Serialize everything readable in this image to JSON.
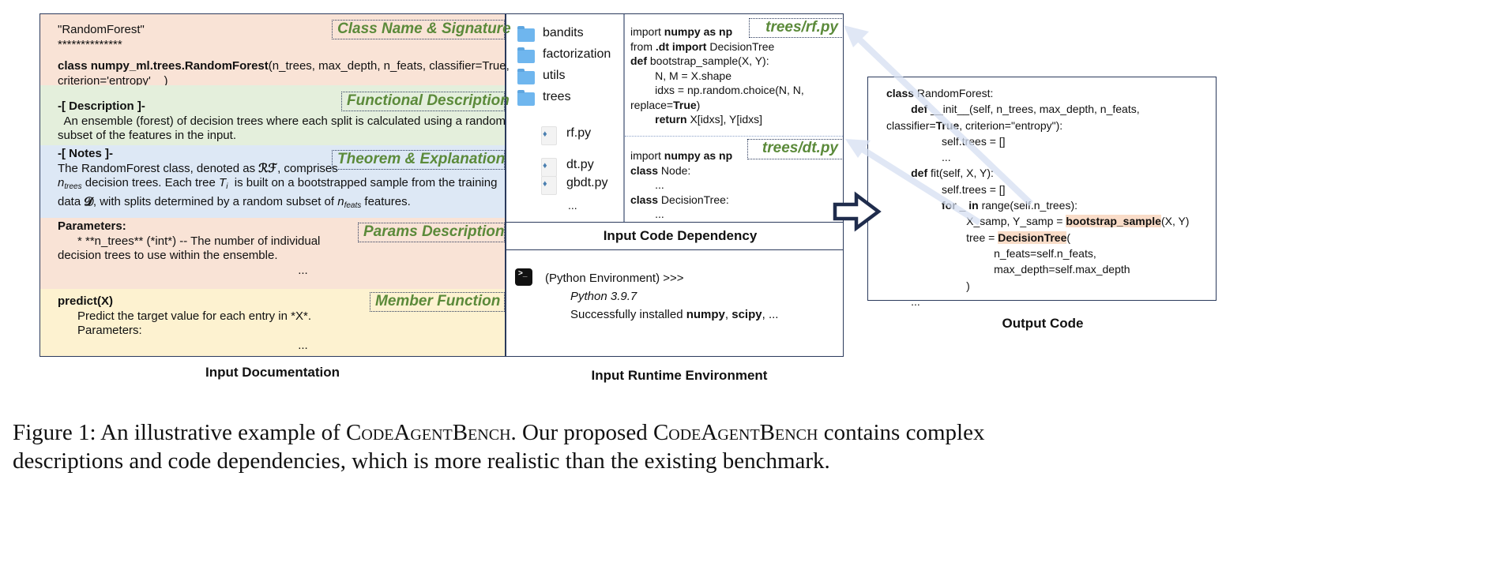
{
  "documentation": {
    "label": "Input Documentation",
    "colors": {
      "signature": "#f9e3d6",
      "description": "#e4efdc",
      "notes": "#dde8f5",
      "params": "#f9e3d6",
      "member": "#fdf2d0",
      "tag_text": "#5b8a3a",
      "border": "#2b3a5c"
    },
    "sections": [
      {
        "tag": "Class Name & Signature",
        "lines": [
          [
            [
              "\"RandomForest\"",
              ""
            ]
          ],
          [
            [
              "**************",
              ""
            ]
          ],
          [
            [
              "class numpy_ml.trees.RandomForest",
              "b"
            ],
            [
              "(n_trees, max_depth, n_feats, classifier=True,",
              ""
            ]
          ],
          [
            [
              "criterion='entropy'    )",
              ""
            ]
          ]
        ]
      },
      {
        "tag": "Functional Description",
        "lines": [
          [
            [
              "-[ Description ]-",
              "b"
            ]
          ],
          [
            [
              "  An ensemble (forest) of decision trees where each split is calculated using a random",
              ""
            ]
          ],
          [
            [
              "subset of the features in the input.",
              ""
            ]
          ]
        ]
      },
      {
        "tag": "Theorem & Explanation",
        "lines": [
          [
            [
              "-[ Notes ]-",
              "b"
            ]
          ],
          [
            [
              "The RandomForest class, denoted as ",
              ""
            ],
            [
              "ℛℱ",
              "b"
            ],
            [
              ", comprises",
              ""
            ]
          ],
          [
            [
              "n",
              "mi"
            ],
            [
              "trees",
              "sub"
            ],
            [
              " decision trees. Each tree ",
              ""
            ],
            [
              "T",
              "mi"
            ],
            [
              "i",
              "sub"
            ],
            [
              "  is built on a bootstrapped sample from the training",
              ""
            ]
          ],
          [
            [
              "data ",
              ""
            ],
            [
              "𝓓",
              "b"
            ],
            [
              ", with splits determined by a random subset of ",
              ""
            ],
            [
              "n",
              "mi"
            ],
            [
              "feats",
              "sub"
            ],
            [
              " features.",
              ""
            ]
          ]
        ]
      },
      {
        "tag": "Params Description",
        "lines": [
          [
            [
              "Parameters:",
              "b"
            ]
          ],
          [
            [
              "      * **n_trees** (*int*) -- The number of individual",
              ""
            ]
          ],
          [
            [
              "decision trees to use within the ensemble.",
              ""
            ]
          ],
          [
            [
              "                                                                         ...",
              ""
            ]
          ]
        ]
      },
      {
        "tag": "Member Function",
        "lines": [
          [
            [
              "predict(X)",
              "b"
            ]
          ],
          [
            [
              "      Predict the target value for each entry in *X*.",
              ""
            ]
          ],
          [
            [
              "      Parameters:",
              ""
            ]
          ],
          [
            [
              "                                                                         ...",
              ""
            ]
          ]
        ]
      }
    ]
  },
  "dependency": {
    "label": "Input Code Dependency",
    "folders": [
      "bandits",
      "factorization",
      "utils",
      "trees"
    ],
    "files": [
      "rf.py",
      "dt.py",
      "gbdt.py"
    ],
    "more": "...",
    "rf": {
      "tag": "trees/rf.py",
      "lines": [
        [
          [
            "import ",
            ""
          ],
          [
            "numpy as np",
            "b"
          ]
        ],
        [
          [
            "from ",
            ""
          ],
          [
            ".dt import",
            "b"
          ],
          [
            " DecisionTree",
            ""
          ]
        ],
        [
          [
            "def",
            "b"
          ],
          [
            " bootstrap_sample(X, Y):",
            ""
          ]
        ],
        [
          [
            "        N, M = X.shape",
            ""
          ]
        ],
        [
          [
            "        idxs = np.random.choice(N, N,",
            ""
          ]
        ],
        [
          [
            "replace=",
            ""
          ],
          [
            "True",
            "b"
          ],
          [
            ")",
            ""
          ]
        ],
        [
          [
            "        ",
            ""
          ],
          [
            "return",
            "b"
          ],
          [
            " X[idxs], Y[idxs]",
            ""
          ]
        ]
      ]
    },
    "dt": {
      "tag": "trees/dt.py",
      "lines": [
        [
          [
            "import ",
            ""
          ],
          [
            "numpy as np",
            "b"
          ]
        ],
        [
          [
            "class",
            "b"
          ],
          [
            " Node:",
            ""
          ]
        ],
        [
          [
            "        ...",
            ""
          ]
        ],
        [
          [
            "class",
            "b"
          ],
          [
            " DecisionTree:",
            ""
          ]
        ],
        [
          [
            "        ...",
            ""
          ]
        ]
      ]
    }
  },
  "runtime": {
    "label": "Input Runtime Environment",
    "prompt": "(Python Environment) >>>",
    "version": "Python 3.9.7",
    "install": [
      [
        "Successfully installed ",
        ""
      ],
      [
        "numpy",
        "b"
      ],
      [
        ", ",
        ""
      ],
      [
        "scipy",
        "b"
      ],
      [
        ", ...",
        ""
      ]
    ]
  },
  "output": {
    "label": "Output Code",
    "lines": [
      [
        [
          "class",
          "b"
        ],
        [
          " RandomForest:",
          ""
        ]
      ],
      [
        [
          "        ",
          ""
        ],
        [
          "def",
          "b"
        ],
        [
          " __init__(self, n_trees, max_depth, n_feats,",
          ""
        ]
      ],
      [
        [
          "classifier=",
          ""
        ],
        [
          "True",
          "b"
        ],
        [
          ", criterion=\"entropy\"):",
          ""
        ]
      ],
      [
        [
          "                  self.trees = []",
          ""
        ]
      ],
      [
        [
          "                  ...",
          ""
        ]
      ],
      [
        [
          "        ",
          ""
        ],
        [
          "def",
          "b"
        ],
        [
          " fit(self, X, Y):",
          ""
        ]
      ],
      [
        [
          "                  self.trees = []",
          ""
        ]
      ],
      [
        [
          "                  ",
          ""
        ],
        [
          "for",
          "b"
        ],
        [
          " _ ",
          ""
        ],
        [
          "in",
          "b"
        ],
        [
          " range(self.n_trees):",
          ""
        ]
      ],
      [
        [
          "                          X_samp, Y_samp = ",
          ""
        ],
        [
          "bootstrap_sample",
          "bhl"
        ],
        [
          "(X, Y)",
          ""
        ]
      ],
      [
        [
          "                          tree = ",
          ""
        ],
        [
          "DecisionTree",
          "bhl"
        ],
        [
          "(",
          ""
        ]
      ],
      [
        [
          "                                   n_feats=self.n_feats,",
          ""
        ]
      ],
      [
        [
          "                                   max_depth=self.max_depth",
          ""
        ]
      ],
      [
        [
          "                          )",
          ""
        ]
      ],
      [
        [
          "        ...",
          ""
        ]
      ]
    ]
  },
  "caption": {
    "line1": [
      [
        "Figure 1: An illustrative example of ",
        ""
      ],
      [
        "CodeAgentBench",
        "sc"
      ],
      [
        ". Our proposed ",
        ""
      ],
      [
        "CodeAgentBench",
        "sc"
      ],
      [
        " contains complex",
        ""
      ]
    ],
    "line2": [
      [
        "descriptions and code dependencies, which is more realistic than the existing benchmark.",
        ""
      ]
    ]
  }
}
